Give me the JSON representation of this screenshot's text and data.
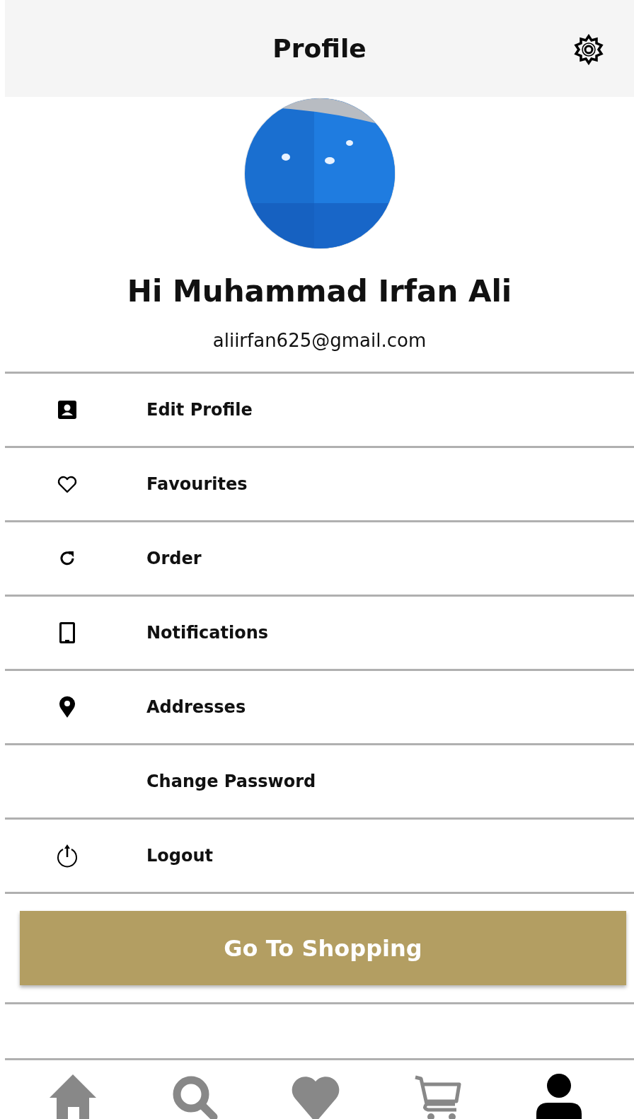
{
  "header": {
    "title": "Profile"
  },
  "profile": {
    "greeting": "Hi Muhammad Irfan Ali",
    "email": "aliirfan625@gmail.com"
  },
  "menu": [
    {
      "label": "Edit Profile"
    },
    {
      "label": "Favourites"
    },
    {
      "label": "Order"
    },
    {
      "label": "Notifications"
    },
    {
      "label": "Addresses"
    },
    {
      "label": "Change Password"
    },
    {
      "label": "Logout"
    }
  ],
  "primary_button": "Go To Shopping",
  "bottom_nav": [
    {
      "selected": false
    },
    {
      "selected": false
    },
    {
      "selected": false
    },
    {
      "selected": false
    },
    {
      "selected": true
    }
  ]
}
